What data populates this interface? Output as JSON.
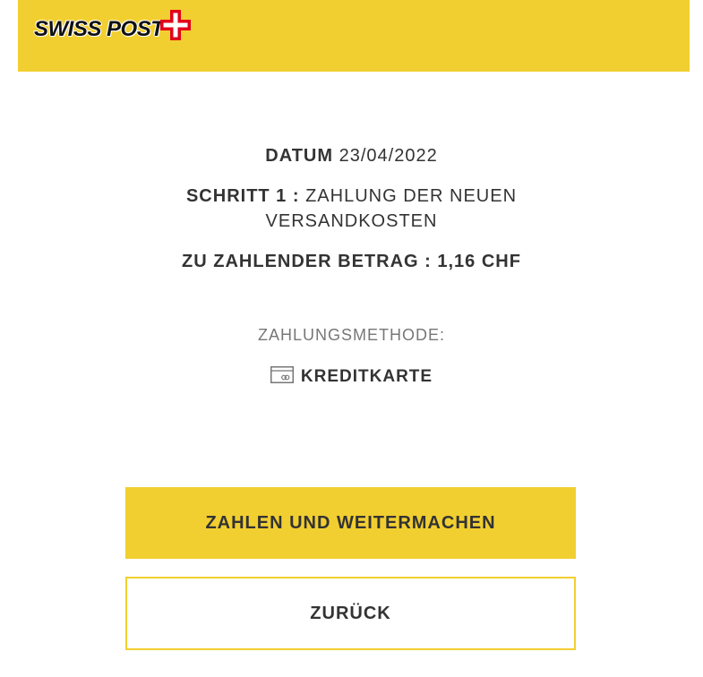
{
  "header": {
    "logo_text": "SWISS POST",
    "brand_color": "#f2cf30",
    "logo_cross_color": "#e2001a"
  },
  "details": {
    "date_label": "DATUM",
    "date_value": "23/04/2022",
    "step_label": "SCHRITT 1 :",
    "step_value": "ZAHLUNG DER NEUEN VERSANDKOSTEN",
    "amount_label": "ZU ZAHLENDER BETRAG :",
    "amount_value": "1,16 CHF"
  },
  "payment": {
    "method_label": "ZAHLUNGSMETHODE:",
    "method_icon": "credit-card-icon",
    "method_value": "KREDITKARTE"
  },
  "actions": {
    "pay_label": "ZAHLEN UND WEITERMACHEN",
    "back_label": "ZURÜCK"
  }
}
